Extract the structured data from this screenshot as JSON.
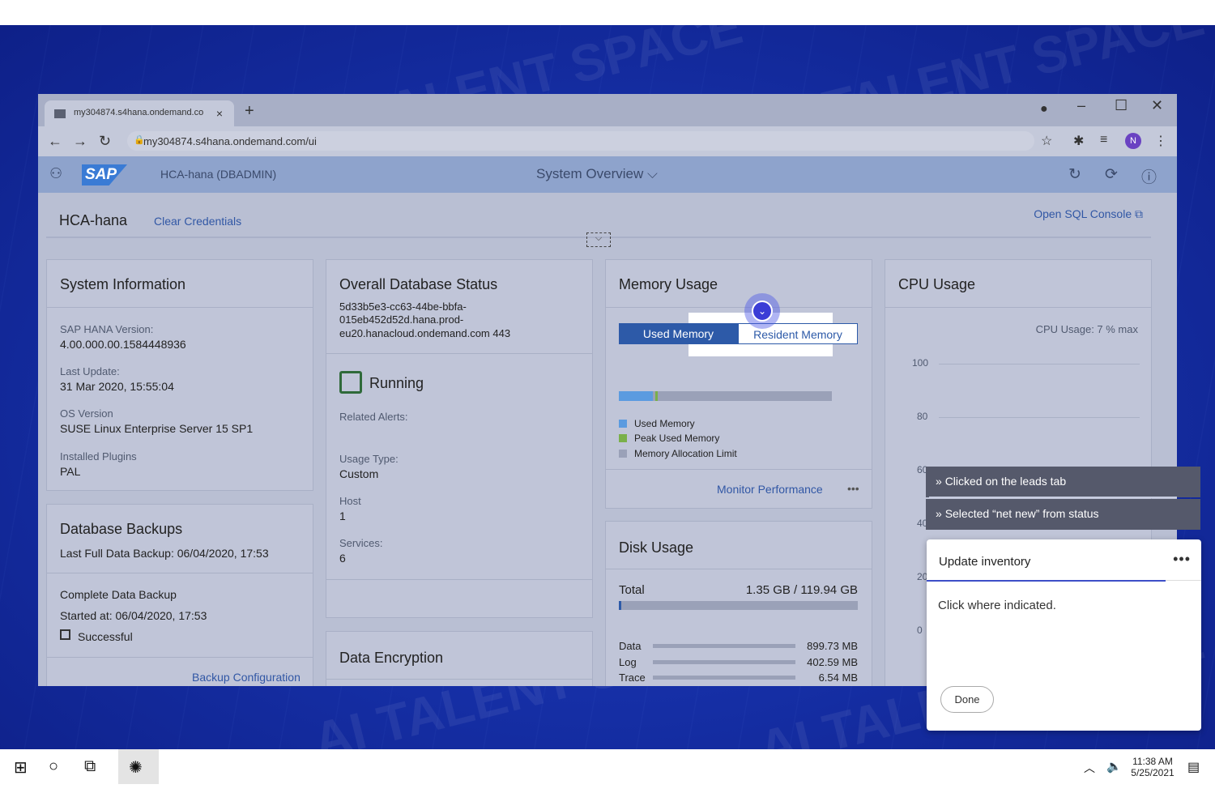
{
  "browser": {
    "tab_title": "my304874.s4hana.ondemand.co",
    "tab_close": "×",
    "new_tab": "+",
    "url": "my304874.s4hana.ondemand.com/ui",
    "profile_initial": "N"
  },
  "shell": {
    "logo": "SAP",
    "system": "HCA-hana (DBADMIN)",
    "title": "System Overview"
  },
  "header": {
    "title": "HCA-hana",
    "clear_credentials": "Clear Credentials",
    "open_sql_console": "Open SQL Console"
  },
  "system_information": {
    "title": "System Information",
    "fields": [
      {
        "label": "SAP HANA Version:",
        "value": "4.00.000.00.1584448936"
      },
      {
        "label": "Last Update:",
        "value": "31 Mar 2020, 15:55:04"
      },
      {
        "label": "OS Version",
        "value": "SUSE Linux Enterprise Server 15 SP1"
      },
      {
        "label": "Installed Plugins",
        "value": "PAL"
      }
    ]
  },
  "database_backups": {
    "title": "Database Backups",
    "last_full": "Last Full Data Backup: 06/04/2020, 17:53",
    "type": "Complete Data Backup",
    "started": "Started at: 06/04/2020, 17:53",
    "status": "Successful",
    "link": "Backup Configuration"
  },
  "db_status": {
    "title": "Overall Database Status",
    "host_line1": "5d33b5e3-cc63-44be-bbfa-",
    "host_line2": "015eb452d52d.hana.prod-",
    "host_line3": "eu20.hanacloud.ondemand.com 443",
    "state": "Running",
    "related_alerts": "Related Alerts:",
    "usage_type_label": "Usage Type:",
    "usage_type": "Custom",
    "host_label": "Host",
    "host_value": "1",
    "services_label": "Services:",
    "services_value": "6"
  },
  "data_encryption": {
    "title": "Data Encryption"
  },
  "memory_usage": {
    "title": "Memory Usage",
    "tabs": [
      "Used Memory",
      "Resident Memory"
    ],
    "active_tab": "Used Memory",
    "used_fraction": 0.16,
    "peak_fraction": 0.17,
    "legend": [
      "Used Memory",
      "Peak Used Memory",
      "Memory Allocation Limit"
    ],
    "colors": {
      "used": "#5b9be0",
      "peak": "#7ab04a",
      "limit": "#9aa1b8"
    },
    "link": "Monitor Performance"
  },
  "disk_usage": {
    "title": "Disk Usage",
    "total_label": "Total",
    "total_value": "1.35 GB / 119.94 GB",
    "rows": [
      {
        "label": "Data",
        "value": "899.73 MB"
      },
      {
        "label": "Log",
        "value": "402.59 MB"
      },
      {
        "label": "Trace",
        "value": "6.54 MB"
      }
    ]
  },
  "cpu_usage": {
    "title": "CPU Usage",
    "caption": "CPU Usage: 7 % max",
    "ticks": [
      "100",
      "80",
      "60",
      "40",
      "20",
      "0"
    ]
  },
  "guide": {
    "steps": [
      "Clicked on the leads tab",
      "Selected “net new” from status"
    ],
    "panel_title": "Update inventory",
    "instruction": "Click where indicated.",
    "done": "Done"
  },
  "taskbar": {
    "time": "11:38 AM",
    "date": "5/25/2021"
  },
  "watermark": "AI TALENT SPACE"
}
